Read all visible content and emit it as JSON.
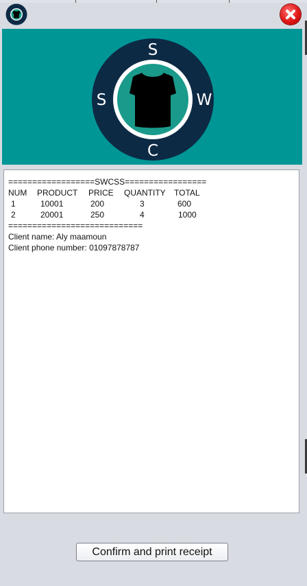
{
  "window": {
    "close_icon": "close-icon",
    "app_icon": "shirt-logo-icon"
  },
  "logo": {
    "letters": {
      "top": "S",
      "left": "S",
      "right": "W",
      "bottom": "C"
    },
    "colors": {
      "ring": "#0d2a45",
      "inner": "#1a9a8a",
      "banner": "#009696"
    }
  },
  "receipt": {
    "separator_top": "==================SWCSS=================",
    "headers": [
      "NUM",
      "PRODUCT",
      "PRICE",
      "QUANTITY",
      "TOTAL"
    ],
    "rows": [
      [
        "1",
        "10001",
        "200",
        "3",
        "600"
      ],
      [
        "2",
        "20001",
        "250",
        "4",
        "1000"
      ]
    ],
    "separator_bottom": "============================",
    "client_name_line": "Client name: Aly maamoun",
    "client_phone_line": "Client phone number: 01097878787"
  },
  "actions": {
    "confirm_label": "Confirm and print receipt"
  }
}
